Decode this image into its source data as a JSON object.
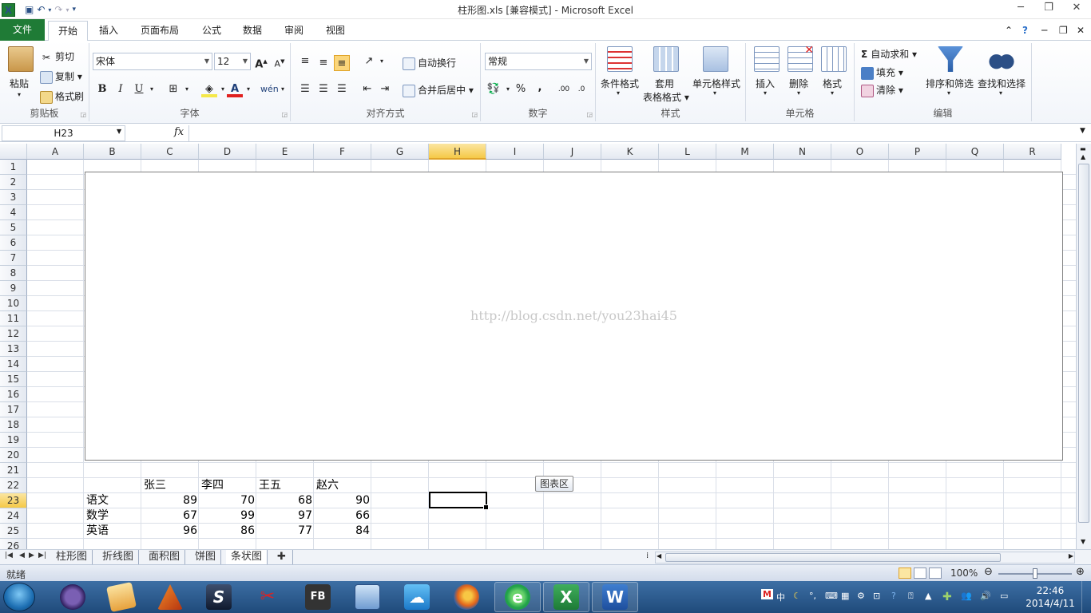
{
  "window": {
    "title": "柱形图.xls  [兼容模式] - Microsoft Excel",
    "app_icon": "X",
    "controls": [
      "─",
      "❐",
      "✕"
    ]
  },
  "ribbon_tabs": [
    "文件",
    "开始",
    "插入",
    "页面布局",
    "公式",
    "数据",
    "审阅",
    "视图"
  ],
  "ribbon": {
    "clipboard": {
      "paste": "粘贴",
      "cut": "剪切",
      "copy": "复制",
      "format_painter": "格式刷",
      "label": "剪贴板"
    },
    "font": {
      "name": "宋体",
      "size": "12",
      "bold": "B",
      "italic": "I",
      "underline": "U",
      "label": "字体"
    },
    "alignment": {
      "wrap": "自动换行",
      "merge": "合并后居中",
      "label": "对齐方式"
    },
    "number": {
      "format": "常规",
      "percent": "%",
      "comma": ",",
      "label": "数字"
    },
    "styles": {
      "conditional": "条件格式",
      "table_line1": "套用",
      "table_line2": "表格格式",
      "cell_styles": "单元格样式",
      "label": "样式"
    },
    "cells": {
      "insert": "插入",
      "delete": "删除",
      "format": "格式",
      "label": "单元格"
    },
    "editing": {
      "autosum": "自动求和",
      "fill": "填充",
      "clear": "清除",
      "sort": "排序和筛选",
      "find": "查找和选择",
      "label": "编辑"
    }
  },
  "formula_bar": {
    "name_box": "H23",
    "fx": "fx",
    "value": ""
  },
  "grid": {
    "columns": [
      "A",
      "B",
      "C",
      "D",
      "E",
      "F",
      "G",
      "H",
      "I",
      "J",
      "K",
      "L",
      "M",
      "N",
      "O",
      "P",
      "Q",
      "R"
    ],
    "selected_column": "H",
    "rows": [
      "1",
      "2",
      "3",
      "4",
      "5",
      "6",
      "7",
      "8",
      "9",
      "10",
      "11",
      "12",
      "13",
      "14",
      "15",
      "16",
      "17",
      "18",
      "19",
      "20",
      "21",
      "22",
      "23",
      "24",
      "25",
      "26"
    ],
    "selected_row": "23",
    "headers": [
      "张三",
      "李四",
      "王五",
      "赵六"
    ],
    "table": [
      {
        "subject": "语文",
        "values": [
          "89",
          "70",
          "68",
          "90"
        ]
      },
      {
        "subject": "数学",
        "values": [
          "67",
          "99",
          "97",
          "66"
        ]
      },
      {
        "subject": "英语",
        "values": [
          "96",
          "86",
          "77",
          "84"
        ]
      }
    ]
  },
  "chart": {
    "watermark": "http://blog.csdn.net/you23hai45",
    "tooltip": "图表区"
  },
  "sheet_tabs": [
    "柱形图",
    "折线图",
    "面积图",
    "饼图",
    "条状图"
  ],
  "active_sheet": "条状图",
  "status": {
    "ready": "就绪",
    "zoom": "100%"
  },
  "taskbar": {
    "apps": [
      "eclipse",
      "notepad",
      "matlab",
      "S",
      "snipping",
      "FB",
      "box",
      "cloud",
      "firefox",
      "ie",
      "excel",
      "word"
    ],
    "fb_label": "FB",
    "s_label": "S",
    "excel_label": "X",
    "word_label": "W",
    "ime": "中",
    "time": "22:46",
    "date": "2014/4/11"
  }
}
